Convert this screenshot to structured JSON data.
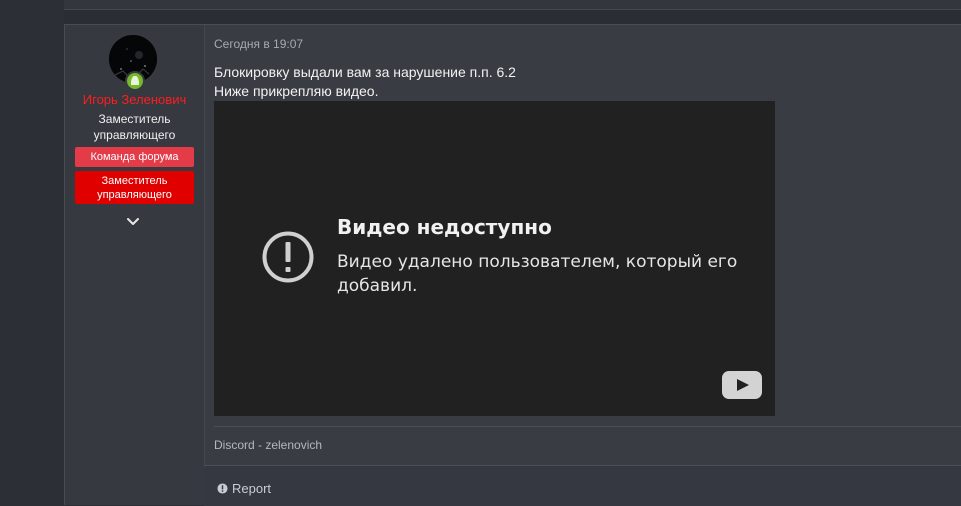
{
  "post": {
    "author": {
      "name": "Игорь Зеленович",
      "title": "Заместитель управляющего",
      "banners": [
        "Команда форума",
        "Заместитель управляющего"
      ],
      "status": "online",
      "colors": {
        "name": "#ff1d1d",
        "banner_1": "#e33b47",
        "banner_2": "#e00000",
        "online": "#75b82a"
      }
    },
    "date": "Сегодня в 19:07",
    "message": {
      "line_1": "Блокировку выдали вам за нарушение п.п. 6.2",
      "line_2": "Ниже прикрепляю видео."
    },
    "video": {
      "title": "Видео недоступно",
      "subtitle": "Видео удалено пользователем, который его добавил.",
      "icons": [
        "alert-circle-icon",
        "youtube-play-icon"
      ]
    },
    "signature": "Discord - zelenovich",
    "actions": {
      "report_label": "Report"
    }
  }
}
